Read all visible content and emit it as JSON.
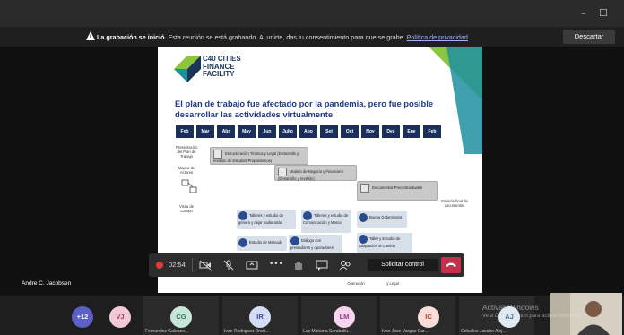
{
  "window": {
    "minimize": "–",
    "maximize": "☐",
    "close": "✕"
  },
  "banner": {
    "bold": "La grabación se inició.",
    "text": " Esta reunión se está grabando. Al unirte, das tu consentimiento para que se grabe. ",
    "link": "Política de privacidad",
    "dismiss": "Descartar"
  },
  "slide": {
    "logo_line1": "C40 CITIES",
    "logo_line2": "FINANCE",
    "logo_line3": "FACILITY",
    "title": "El plan de trabajo fue afectado por la pandemia, pero fue posible desarrollar las actividades virtualmente",
    "months": [
      "Feb",
      "Mar",
      "Abr",
      "May",
      "Jun",
      "Julio",
      "Ago",
      "Set",
      "Oct",
      "Nov",
      "Dec",
      "Ene",
      "Feb"
    ],
    "left_labels": [
      "Presentación del Plan de Trabajo",
      "Mapeo de Actores",
      "Visita de Campo"
    ],
    "gray_boxes": [
      "Estructuración Técnica y Legal (Desarrollo y revisión de Estudios Preparatorios)",
      "Modelo de Negocio y Financiero (Desarrollo y revisión)",
      "Documentos Precontractuales"
    ],
    "right_label": "Emisión final de documentos",
    "workshops": [
      "Talleres y estudio de género y dejar nadie atrás",
      "Talleres y estudio de Comunicación y Marca",
      "Buena Gobernanza",
      "Estudio de Mercado",
      "Diálogo con prestadores y operadores",
      "Taller y Estudio de Adaptación al Cambio",
      "Operación",
      "y Legal"
    ]
  },
  "presenter_name": "Andre C. Jacobsen",
  "toolbar": {
    "timer": "02:54",
    "camera_icon": "camera-off-icon",
    "mic_icon": "mic-off-icon",
    "share_icon": "share-screen-icon",
    "more": "•••",
    "raise_hand_icon": "raise-hand-icon",
    "chat_icon": "chat-icon",
    "people_icon": "participants-icon",
    "request_control": "Solicitar control",
    "hangup_icon": "hang-up-icon"
  },
  "participants": [
    {
      "initials": "+12",
      "name": "",
      "color": "#5b5fc7",
      "text": "#fff"
    },
    {
      "initials": "VJ",
      "name": "",
      "color": "#f2c9d6",
      "text": "#a33e65"
    },
    {
      "initials": "CG",
      "name": "Fernandez Galeano...",
      "color": "#c8e6d8",
      "text": "#2d7a5a"
    },
    {
      "initials": "IR",
      "name": "Ivan Rodriguez (Invit...",
      "color": "#d5dcf5",
      "text": "#3b4a9c"
    },
    {
      "initials": "LM",
      "name": "Luz Mariana Sarabaliú...",
      "color": "#f5d5ee",
      "text": "#a0358a"
    },
    {
      "initials": "IC",
      "name": "Ivan Jose Vargas Car...",
      "color": "#f7ddd5",
      "text": "#a7452c"
    },
    {
      "initials": "AJ",
      "name": "Ceballos Jacobo Alej...",
      "color": "#dfe9f2",
      "text": "#355d85"
    },
    {
      "initials": "",
      "name": "Andre C. Jacobsen",
      "color": "#c8c2b3",
      "text": "#333"
    }
  ],
  "activate": {
    "line1": "Activar Windows",
    "line2": "Ve a Configuración para activar Windows."
  }
}
